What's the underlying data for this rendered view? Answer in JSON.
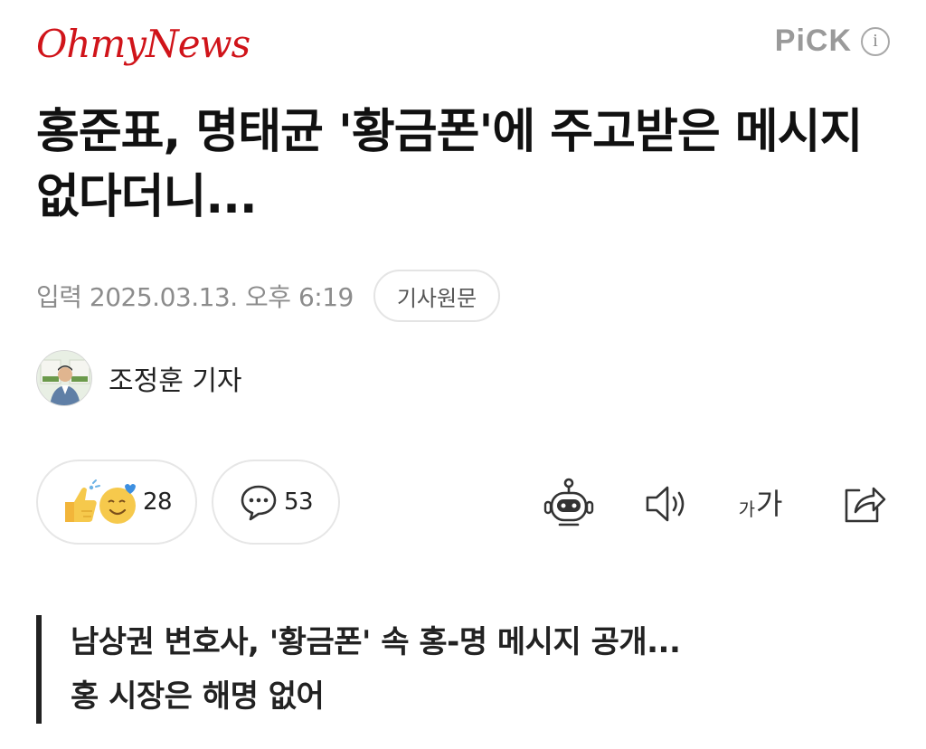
{
  "header": {
    "logo_text": "OhmyNews",
    "pick_label": "PiCK",
    "info_icon_text": "i"
  },
  "article": {
    "title": "홍준표, 명태균 '황금폰'에 주고받은 메시지 없다더니...",
    "published": "입력 2025.03.13. 오후 6:19",
    "source_button": "기사원문",
    "reporter": "조정훈 기자",
    "subtitle_line1": "남상권 변호사, '황금폰' 속 홍-명 메시지 공개...",
    "subtitle_line2": "홍 시장은 해명 없어"
  },
  "actions": {
    "reaction_count": "28",
    "comment_count": "53",
    "font_small": "가",
    "font_big": "가"
  },
  "colors": {
    "logo_red": "#d0141a",
    "pick_gray": "#9a9a9a",
    "meta_gray": "#8c8c8c",
    "emoji_yellow": "#f6c94c"
  },
  "icons": [
    "thumbs-up-emoji-icon",
    "heart-eyes-emoji-icon",
    "comment-bubble-icon",
    "robot-icon",
    "speaker-icon",
    "share-icon"
  ]
}
